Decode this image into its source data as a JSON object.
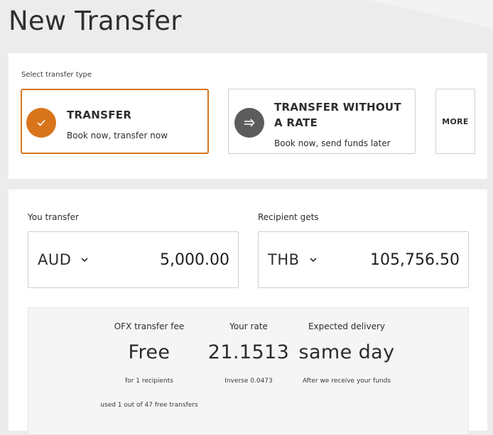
{
  "page": {
    "title": "New Transfer"
  },
  "transfer_type": {
    "heading": "Select transfer type",
    "options": [
      {
        "title": "TRANSFER",
        "subtitle": "Book now, transfer now",
        "icon": "check-icon",
        "selected": true
      },
      {
        "title": "TRANSFER WITHOUT A RATE",
        "subtitle": "Book now, send funds later",
        "icon": "arrow-right-icon",
        "selected": false
      }
    ],
    "more_label": "MORE"
  },
  "amounts": {
    "send": {
      "label": "You transfer",
      "currency": "AUD",
      "amount": "5,000.00"
    },
    "receive": {
      "label": "Recipient gets",
      "currency": "THB",
      "amount": "105,756.50"
    }
  },
  "summary": {
    "fee": {
      "label": "OFX transfer fee",
      "value": "Free",
      "note": "for 1 recipients",
      "note2": "used 1 out of 47 free transfers"
    },
    "rate": {
      "label": "Your rate",
      "value": "21.1513",
      "note": "Inverse 0.0473"
    },
    "delivery": {
      "label": "Expected delivery",
      "value": "same day",
      "note": "After we receive your funds"
    }
  },
  "colors": {
    "accent": "#d8751b",
    "secondary_icon_bg": "#5c5c5c",
    "page_bg": "#ececec"
  }
}
